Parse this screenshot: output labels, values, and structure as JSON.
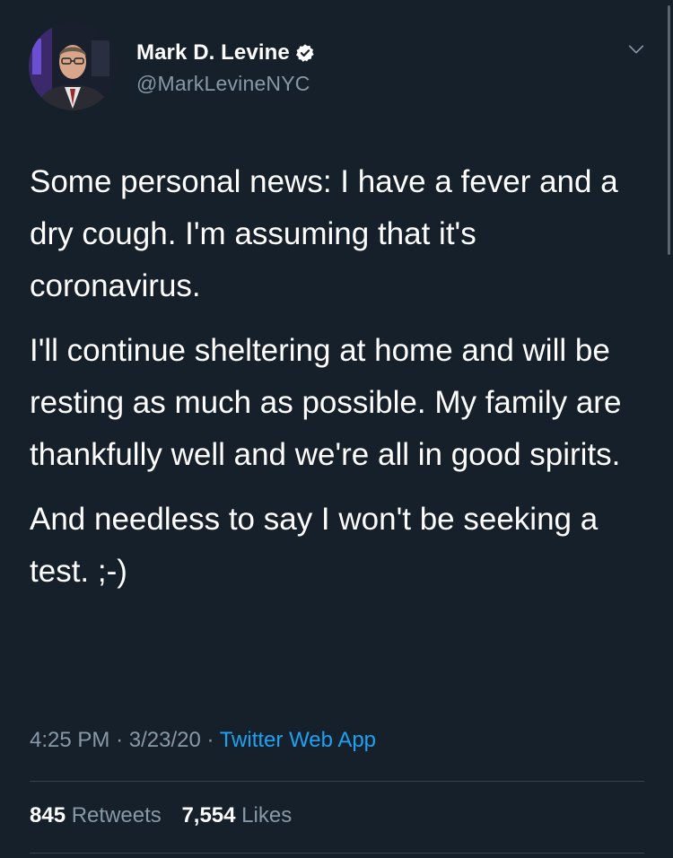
{
  "user": {
    "display_name": "Mark D. Levine",
    "handle": "@MarkLevineNYC",
    "verified": true,
    "avatar_icon": "profile-photo"
  },
  "tweet": {
    "paragraphs": [
      "Some personal news: I have a fever and a dry cough. I'm assuming that it's coronavirus.",
      "I'll continue sheltering at home and will be resting as much as possible. My family are thankfully well and we're all in good spirits.",
      "And needless to say I won't be seeking a test. ;-)"
    ],
    "time": "4:25 PM",
    "separator": "·",
    "date": "3/23/20",
    "source": "Twitter Web App"
  },
  "stats": {
    "retweets_count": "845",
    "retweets_label": "Retweets",
    "likes_count": "7,554",
    "likes_label": "Likes"
  },
  "colors": {
    "background": "#15202b",
    "text": "#ffffff",
    "muted": "#8899a6",
    "accent": "#1da1f2",
    "divider": "#38444d"
  }
}
